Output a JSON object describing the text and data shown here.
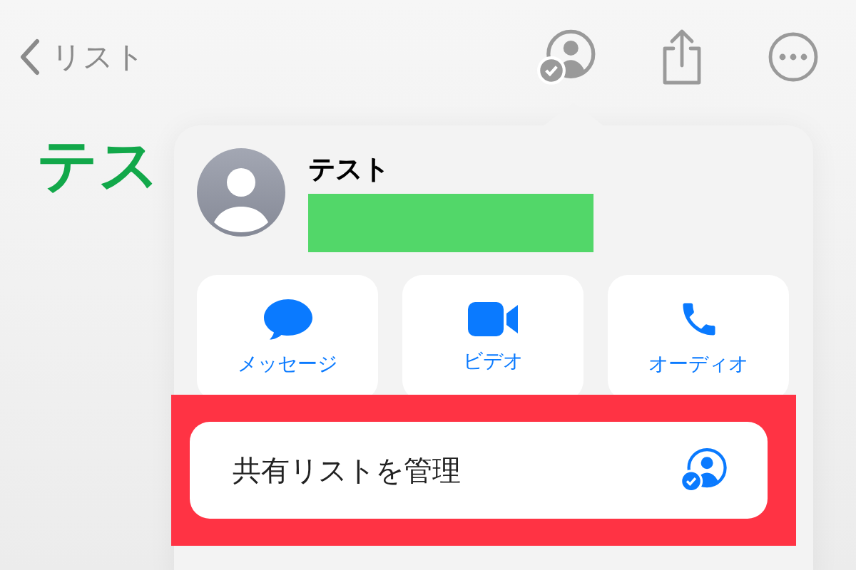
{
  "nav": {
    "back_label": "リスト"
  },
  "title": "テス",
  "popover": {
    "contact": {
      "name": "テスト"
    },
    "actions": [
      {
        "kind": "message",
        "label": "メッセージ"
      },
      {
        "kind": "video",
        "label": "ビデオ"
      },
      {
        "kind": "audio",
        "label": "オーディオ"
      }
    ],
    "manage": {
      "label": "共有リストを管理",
      "highlighted": true
    }
  }
}
